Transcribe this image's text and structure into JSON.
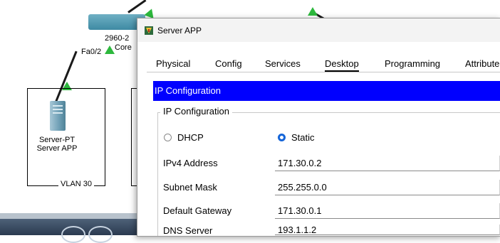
{
  "topology": {
    "switch": {
      "model_label": "2960-2",
      "role_label": "Core"
    },
    "port_label": "Fa0/2",
    "server": {
      "type_label": "Server-PT",
      "name_label": "Server APP"
    },
    "vlan_label": "VLAN 30"
  },
  "window": {
    "title": "Server APP",
    "tabs": [
      {
        "label": "Physical",
        "active": false
      },
      {
        "label": "Config",
        "active": false
      },
      {
        "label": "Services",
        "active": false
      },
      {
        "label": "Desktop",
        "active": true
      },
      {
        "label": "Programming",
        "active": false
      },
      {
        "label": "Attribute",
        "active": false
      }
    ],
    "panel_title": "IP Configuration",
    "group_title": "IP Configuration",
    "mode": {
      "dhcp_label": "DHCP",
      "static_label": "Static",
      "selected": "Static"
    },
    "fields": [
      {
        "label": "IPv4 Address",
        "value": "171.30.0.2"
      },
      {
        "label": "Subnet Mask",
        "value": "255.255.0.0"
      },
      {
        "label": "Default Gateway",
        "value": "171.30.0.1"
      },
      {
        "label": "DNS Server",
        "value": "193.1.1.2"
      }
    ]
  },
  "colors": {
    "panel_header": "#0000ff",
    "radio_selected": "#1565d8",
    "link_up": "#2db83d"
  }
}
